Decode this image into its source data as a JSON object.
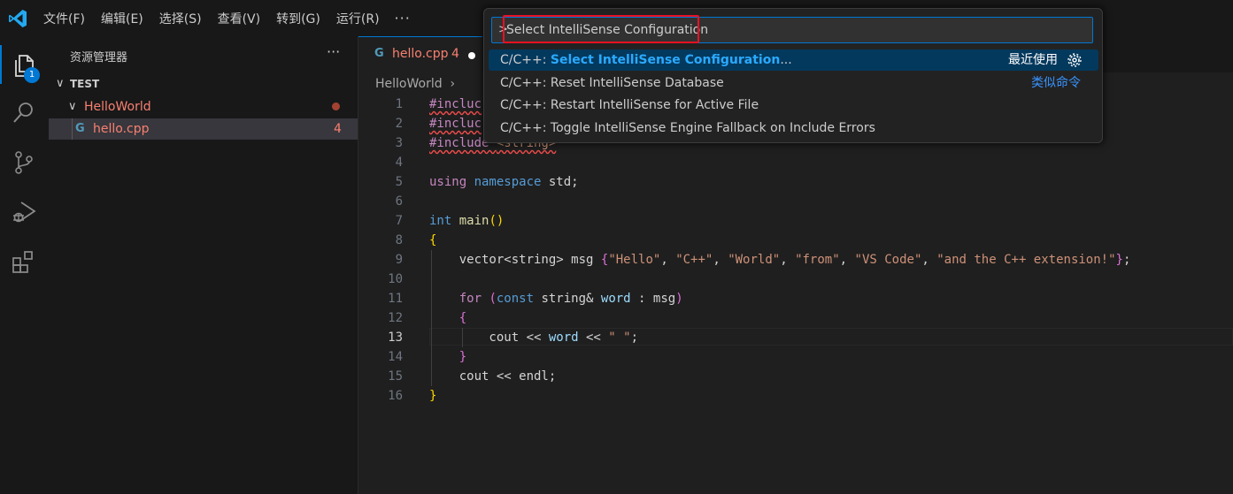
{
  "menu": {
    "items": [
      "文件(F)",
      "编辑(E)",
      "选择(S)",
      "查看(V)",
      "转到(G)",
      "运行(R)"
    ],
    "more": "···"
  },
  "activity": {
    "explorer_badge": "1"
  },
  "sidebar": {
    "title": "资源管理器",
    "more": "···",
    "workspace": "TEST",
    "folder": "HelloWorld",
    "file": "hello.cpp",
    "file_problems": "4"
  },
  "editor": {
    "tab": {
      "label": "hello.cpp",
      "problems": "4",
      "icon": "c-plus-plus-icon"
    },
    "breadcrumb": "HelloWorld",
    "current_line": 13
  },
  "palette": {
    "prompt": ">",
    "value": "Select IntelliSense Configuration",
    "items": [
      {
        "prefix": "C/C++: ",
        "highlight": "Select IntelliSense Configuration",
        "suffix": "...",
        "right": "最近使用",
        "selected": true
      },
      {
        "prefix": "C/C++: Reset IntelliSense Database",
        "highlight": "",
        "suffix": "",
        "right": "类似命令",
        "selected": false
      },
      {
        "prefix": "C/C++: Restart IntelliSense for Active File",
        "highlight": "",
        "suffix": "",
        "right": "",
        "selected": false
      },
      {
        "prefix": "C/C++: Toggle IntelliSense Engine Fallback on Include Errors",
        "highlight": "",
        "suffix": "",
        "right": "",
        "selected": false
      }
    ]
  },
  "code_lines": [
    [
      {
        "t": "#incluc",
        "c": "kw squig"
      }
    ],
    [
      {
        "t": "#incluc",
        "c": "kw squig"
      }
    ],
    [
      {
        "t": "#include ",
        "c": "kw squig"
      },
      {
        "t": "<string>",
        "c": "st squig"
      }
    ],
    [],
    [
      {
        "t": "using ",
        "c": "kw"
      },
      {
        "t": "namespace ",
        "c": "ty"
      },
      {
        "t": "std",
        "c": "id"
      },
      {
        "t": ";",
        "c": "id"
      }
    ],
    [],
    [
      {
        "t": "int ",
        "c": "ty"
      },
      {
        "t": "main",
        "c": "fn"
      },
      {
        "t": "()",
        "c": "br1"
      }
    ],
    [
      {
        "t": "{",
        "c": "br1"
      }
    ],
    [
      {
        "t": "    vector<string> msg ",
        "c": "id"
      },
      {
        "t": "{",
        "c": "br2"
      },
      {
        "t": "\"Hello\"",
        "c": "st"
      },
      {
        "t": ", ",
        "c": "id"
      },
      {
        "t": "\"C++\"",
        "c": "st"
      },
      {
        "t": ", ",
        "c": "id"
      },
      {
        "t": "\"World\"",
        "c": "st"
      },
      {
        "t": ", ",
        "c": "id"
      },
      {
        "t": "\"from\"",
        "c": "st"
      },
      {
        "t": ", ",
        "c": "id"
      },
      {
        "t": "\"VS Code\"",
        "c": "st"
      },
      {
        "t": ", ",
        "c": "id"
      },
      {
        "t": "\"and the C++ extension!\"",
        "c": "st"
      },
      {
        "t": "}",
        "c": "br2"
      },
      {
        "t": ";",
        "c": "id"
      }
    ],
    [],
    [
      {
        "t": "    ",
        "c": "id"
      },
      {
        "t": "for ",
        "c": "kw"
      },
      {
        "t": "(",
        "c": "br2"
      },
      {
        "t": "const ",
        "c": "ty"
      },
      {
        "t": "string& ",
        "c": "id"
      },
      {
        "t": "word",
        "c": "var"
      },
      {
        "t": " : msg",
        "c": "id"
      },
      {
        "t": ")",
        "c": "br2"
      }
    ],
    [
      {
        "t": "    ",
        "c": "id"
      },
      {
        "t": "{",
        "c": "br2"
      }
    ],
    [
      {
        "t": "        cout << ",
        "c": "id"
      },
      {
        "t": "word",
        "c": "var"
      },
      {
        "t": " << ",
        "c": "id"
      },
      {
        "t": "\" \"",
        "c": "st"
      },
      {
        "t": ";",
        "c": "id"
      }
    ],
    [
      {
        "t": "    ",
        "c": "id"
      },
      {
        "t": "}",
        "c": "br2"
      }
    ],
    [
      {
        "t": "    cout << endl;",
        "c": "id"
      }
    ],
    [
      {
        "t": "}",
        "c": "br1"
      }
    ]
  ]
}
